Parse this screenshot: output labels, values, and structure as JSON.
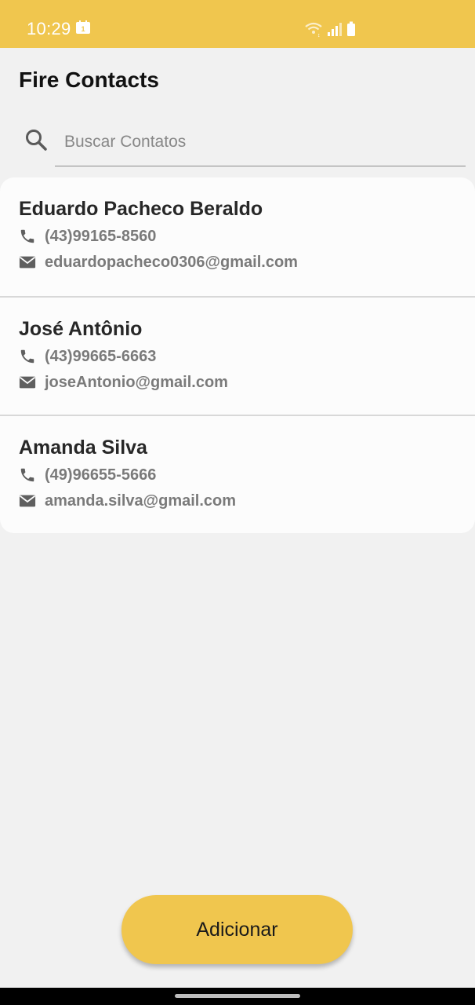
{
  "status_bar": {
    "time": "10:29",
    "background_color": "#f0c64e",
    "icons": [
      "calendar-icon",
      "wifi-icon",
      "signal-icon",
      "battery-icon"
    ]
  },
  "app": {
    "title": "Fire Contacts"
  },
  "search": {
    "placeholder": "Buscar Contatos",
    "value": ""
  },
  "contacts": [
    {
      "name": "Eduardo Pacheco Beraldo",
      "phone": "(43)99165-8560",
      "email": "eduardopacheco0306@gmail.com"
    },
    {
      "name": "José Antônio",
      "phone": "(43)99665-6663",
      "email": "joseAntonio@gmail.com"
    },
    {
      "name": "Amanda Silva",
      "phone": "(49)96655-5666",
      "email": "amanda.silva@gmail.com"
    }
  ],
  "actions": {
    "add_label": "Adicionar"
  },
  "colors": {
    "accent": "#f0c64e",
    "background": "#f1f1f1",
    "card": "#fcfcfc"
  }
}
